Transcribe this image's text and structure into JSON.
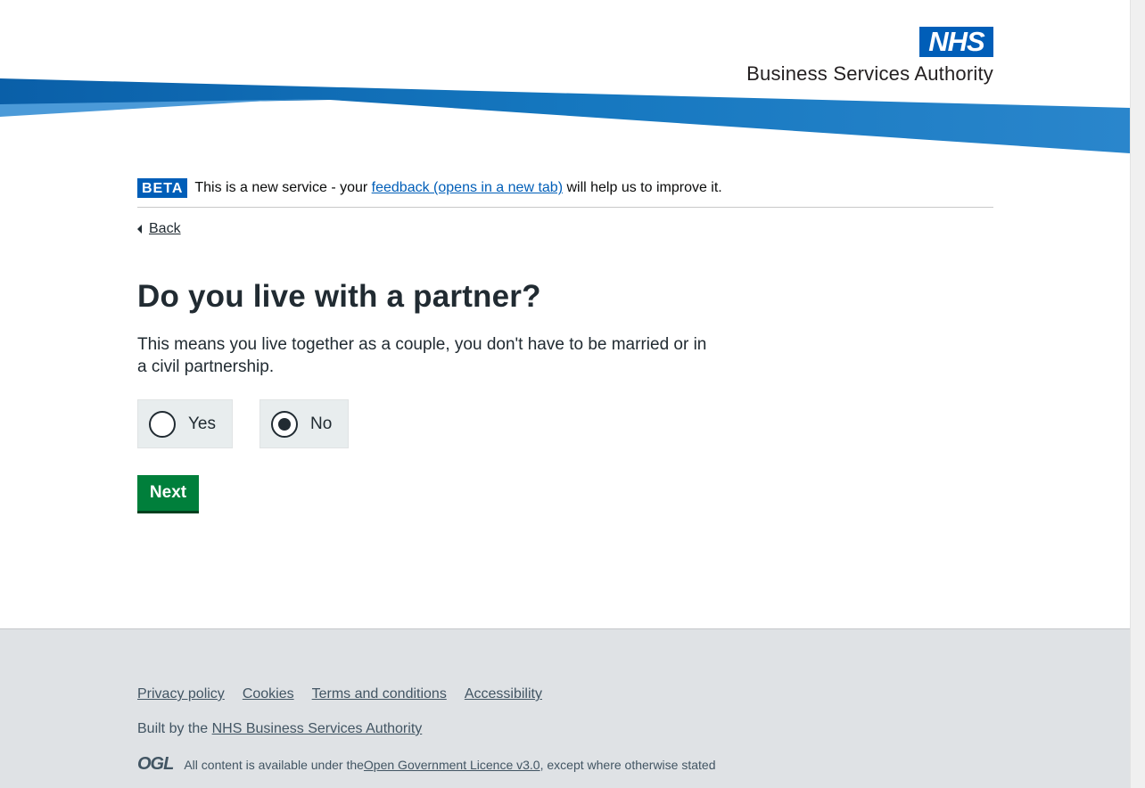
{
  "header": {
    "logo_text": "NHS",
    "org_name": "Business Services Authority"
  },
  "beta": {
    "tag": "BETA",
    "text_before": "This is a new service - your ",
    "link": "feedback (opens in a new tab)",
    "text_after": " will help us to improve it."
  },
  "back_link": "Back",
  "question": {
    "title": "Do you live with a partner?",
    "hint": "This means you live together as a couple, you don't have to be married or in a civil partnership.",
    "options": [
      {
        "label": "Yes",
        "selected": false
      },
      {
        "label": "No",
        "selected": true
      }
    ]
  },
  "next_button": "Next",
  "footer": {
    "links": [
      "Privacy policy",
      "Cookies",
      "Terms and conditions",
      "Accessibility"
    ],
    "built_by_prefix": "Built by the ",
    "built_by_link": "NHS Business Services Authority",
    "ogl_icon": "OGL",
    "licence_prefix": "All content is available under the ",
    "licence_link": "Open Government Licence v3.0",
    "licence_suffix": ", except where otherwise stated"
  },
  "colors": {
    "nhs_blue": "#005eb8",
    "button_green": "#007f3b",
    "footer_bg": "#dfe2e5"
  }
}
